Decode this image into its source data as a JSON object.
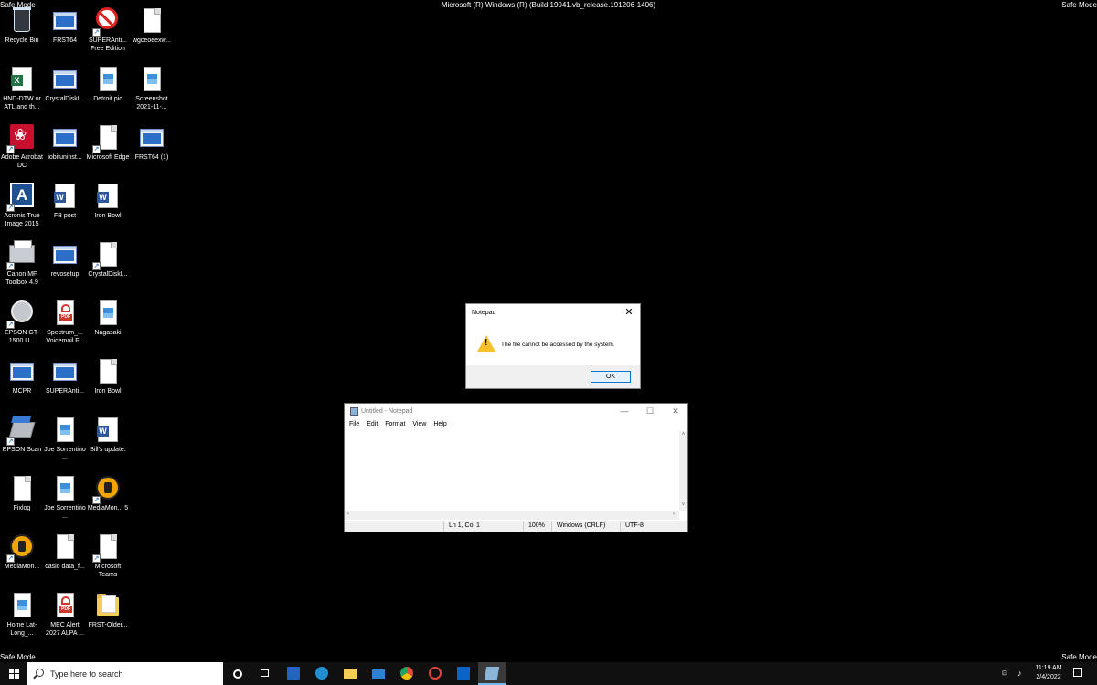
{
  "safe_mode": "Safe Mode",
  "build_text": "Microsoft (R) Windows (R) (Build 19041.vb_release.191206-1406)",
  "desktop_icons": [
    {
      "label": "Recycle Bin"
    },
    {
      "label": "FRST64"
    },
    {
      "label": "SUPERAnti... Free Edition"
    },
    {
      "label": "wgceoeexw..."
    },
    {
      "label": "HND-DTW or ATL and th..."
    },
    {
      "label": "CrystalDiskI..."
    },
    {
      "label": "Detroit pic"
    },
    {
      "label": "Screenshot 2021-11-..."
    },
    {
      "label": "Adobe Acrobat DC"
    },
    {
      "label": "iobituninst..."
    },
    {
      "label": "Microsoft Edge"
    },
    {
      "label": "FRST64 (1)"
    },
    {
      "label": "Acronis True Image 2015"
    },
    {
      "label": "FB post"
    },
    {
      "label": "Iron Bowl"
    },
    {
      "label": "Canon MF Toolbox 4.9"
    },
    {
      "label": "revosetup"
    },
    {
      "label": "CrystalDiskI..."
    },
    {
      "label": "EPSON GT-1500 U..."
    },
    {
      "label": "Spectrum_... Voicemail F..."
    },
    {
      "label": "Nagasaki"
    },
    {
      "label": "MCPR"
    },
    {
      "label": "SUPERAnti..."
    },
    {
      "label": "Iron Bowl"
    },
    {
      "label": "EPSON Scan"
    },
    {
      "label": "Joe Sorrentino ..."
    },
    {
      "label": "Bill's update."
    },
    {
      "label": "Fixlog"
    },
    {
      "label": "Joe Sorrentino ..."
    },
    {
      "label": "MediaMon... 5"
    },
    {
      "label": "MediaMon..."
    },
    {
      "label": "casio data_f..."
    },
    {
      "label": "Microsoft Teams"
    },
    {
      "label": "Home Lat-Long_..."
    },
    {
      "label": "MEC Alert 2027 ALPA ..."
    },
    {
      "label": "FRST-Older..."
    }
  ],
  "dialog": {
    "title": "Notepad",
    "close": "✕",
    "warn_mark": "!",
    "message": "The file cannot be accessed by the system.",
    "ok_label": "OK"
  },
  "notepad": {
    "title": "Untitled - Notepad",
    "minimize": "—",
    "maximize": "☐",
    "close": "✕",
    "menu": [
      "File",
      "Edit",
      "Format",
      "View",
      "Help"
    ],
    "scroll_up": "˄",
    "scroll_down": "˅",
    "scroll_left": "‹",
    "scroll_right": "›",
    "status": {
      "position": "Ln 1, Col 1",
      "zoom": "100%",
      "line_ending": "Windows (CRLF)",
      "encoding": "UTF-8"
    }
  },
  "taskbar": {
    "search_placeholder": "Type here to search",
    "time": "11:19 AM",
    "date": "2/4/2022",
    "colors": {
      "edge": "#1f8fd1",
      "folder": "#f4cd58",
      "mail": "#2f7fd3",
      "chrome": "#dd4b39",
      "outlook": "#0a64c8",
      "store": "#2563c0"
    }
  }
}
